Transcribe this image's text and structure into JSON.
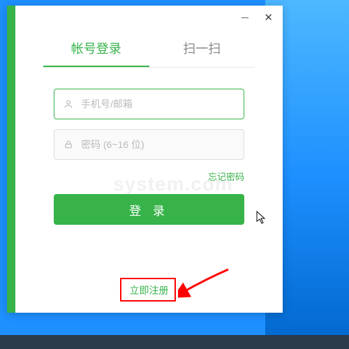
{
  "window": {
    "minimize": "—",
    "close": "✕"
  },
  "tabs": {
    "login": "帐号登录",
    "scan": "扫一扫"
  },
  "fields": {
    "username_placeholder": "手机号/邮箱",
    "password_placeholder": "密码 (6~16 位)"
  },
  "links": {
    "forgot": "忘记密码",
    "register": "立即注册"
  },
  "buttons": {
    "login": "登 录"
  },
  "watermark": "system.com",
  "colors": {
    "primary": "#37b34a",
    "annotation": "#ff0000"
  }
}
